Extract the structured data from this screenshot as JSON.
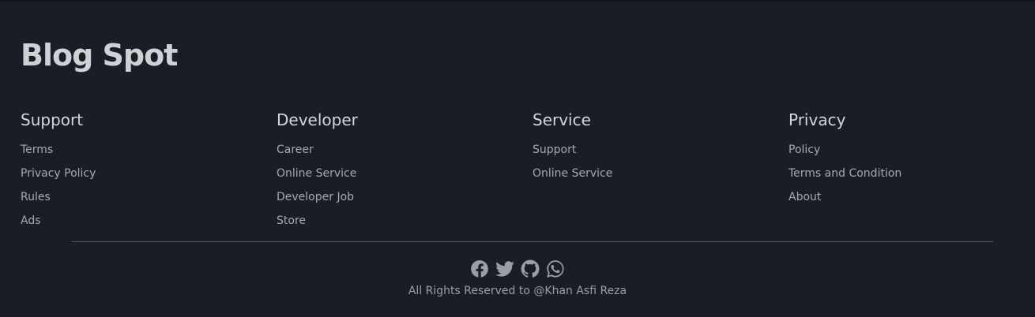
{
  "brand": {
    "title": "Blog Spot"
  },
  "columns": [
    {
      "title": "Support",
      "links": [
        "Terms",
        "Privacy Policy",
        "Rules",
        "Ads"
      ]
    },
    {
      "title": "Developer",
      "links": [
        "Career",
        "Online Service",
        "Developer Job",
        "Store"
      ]
    },
    {
      "title": "Service",
      "links": [
        "Support",
        "Online Service"
      ]
    },
    {
      "title": "Privacy",
      "links": [
        "Policy",
        "Terms and Condition",
        "About"
      ]
    }
  ],
  "social": {
    "icons": [
      "facebook-icon",
      "twitter-icon",
      "github-icon",
      "whatsapp-icon"
    ]
  },
  "copyright": "All Rights Reserved to @Khan Asfi Reza",
  "colors": {
    "background": "#1b1d24",
    "heading": "#d4d6db",
    "link": "#a7a9b0",
    "divider": "#55585f"
  }
}
